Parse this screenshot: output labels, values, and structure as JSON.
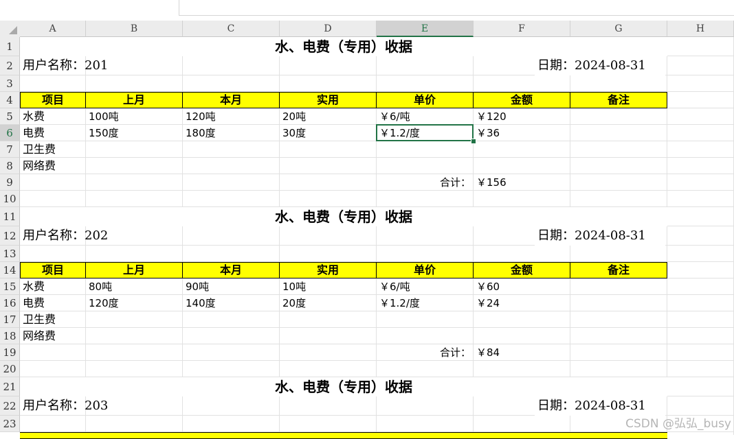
{
  "columns": [
    "A",
    "B",
    "C",
    "D",
    "E",
    "F",
    "G",
    "H"
  ],
  "rows": [
    "1",
    "2",
    "3",
    "4",
    "5",
    "6",
    "7",
    "8",
    "9",
    "10",
    "11",
    "12",
    "13",
    "14",
    "15",
    "16",
    "17",
    "18",
    "19",
    "20",
    "21",
    "22",
    "23"
  ],
  "selected": {
    "column": "E",
    "row": "6"
  },
  "headers": [
    "项目",
    "上月",
    "本月",
    "实用",
    "单价",
    "金额",
    "备注"
  ],
  "receipts": [
    {
      "title": "水、电费（专用）收据",
      "user_label": "用户名称：201",
      "date_label": "日期：2024-08-31",
      "items": [
        {
          "name": "水费",
          "last": "100吨",
          "current": "120吨",
          "used": "20吨",
          "price": "￥6/吨",
          "amount": "￥120"
        },
        {
          "name": "电费",
          "last": "150度",
          "current": "180度",
          "used": "30度",
          "price": "￥1.2/度",
          "amount": "￥36"
        },
        {
          "name": "卫生费",
          "last": "",
          "current": "",
          "used": "",
          "price": "",
          "amount": ""
        },
        {
          "name": "网络费",
          "last": "",
          "current": "",
          "used": "",
          "price": "",
          "amount": ""
        }
      ],
      "total_label": "合计：",
      "total": "￥156"
    },
    {
      "title": "水、电费（专用）收据",
      "user_label": "用户名称：202",
      "date_label": "日期：2024-08-31",
      "items": [
        {
          "name": "水费",
          "last": "80吨",
          "current": "90吨",
          "used": "10吨",
          "price": "￥6/吨",
          "amount": "￥60"
        },
        {
          "name": "电费",
          "last": "120度",
          "current": "140度",
          "used": "20度",
          "price": "￥1.2/度",
          "amount": "￥24"
        },
        {
          "name": "卫生费",
          "last": "",
          "current": "",
          "used": "",
          "price": "",
          "amount": ""
        },
        {
          "name": "网络费",
          "last": "",
          "current": "",
          "used": "",
          "price": "",
          "amount": ""
        }
      ],
      "total_label": "合计：",
      "total": "￥84"
    },
    {
      "title": "水、电费（专用）收据",
      "user_label": "用户名称：203",
      "date_label": "日期：2024-08-31"
    }
  ],
  "watermark": "CSDN @弘弘_busy"
}
